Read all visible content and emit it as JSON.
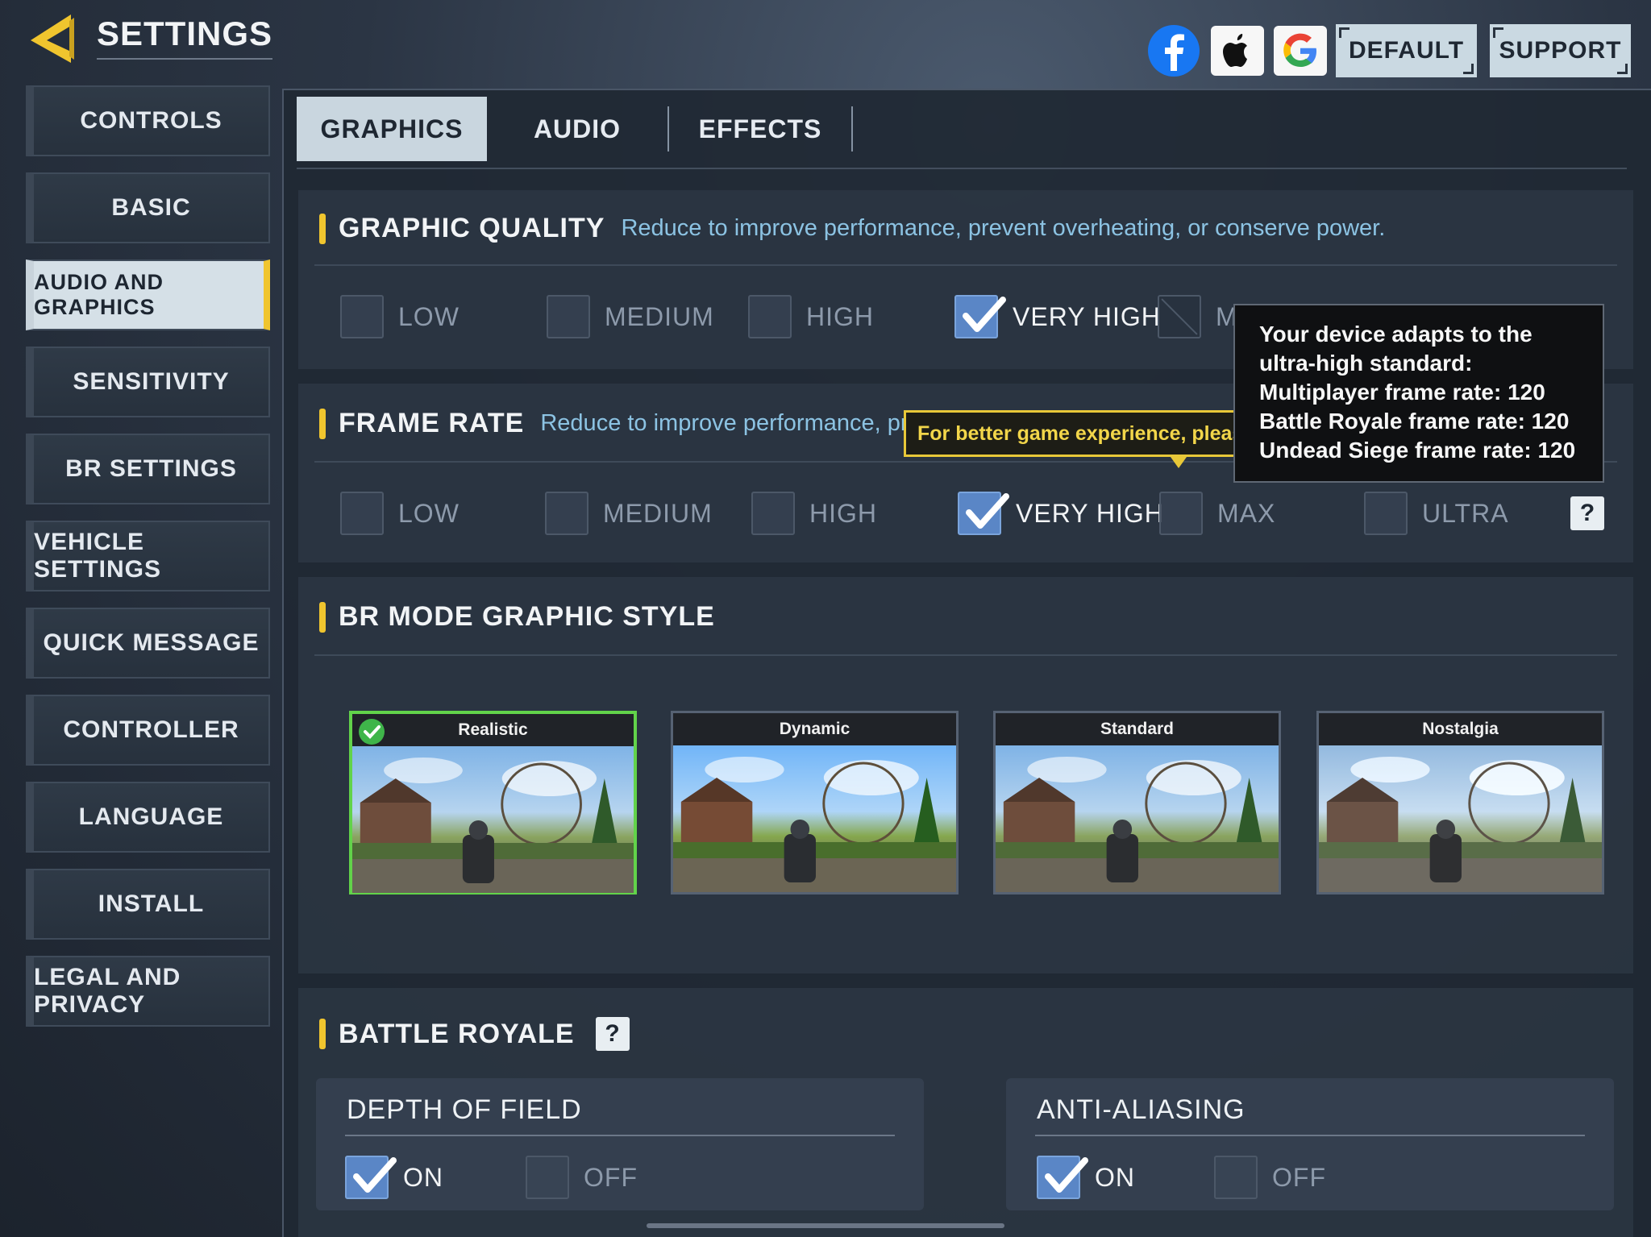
{
  "header": {
    "title": "SETTINGS",
    "default_label": "DEFAULT",
    "support_label": "SUPPORT",
    "colors": {
      "accent": "#f0c52e",
      "facebook": "#1877f2"
    }
  },
  "sidebar": {
    "items": [
      {
        "label": "CONTROLS"
      },
      {
        "label": "BASIC"
      },
      {
        "label": "AUDIO AND GRAPHICS"
      },
      {
        "label": "SENSITIVITY"
      },
      {
        "label": "BR SETTINGS"
      },
      {
        "label": "VEHICLE SETTINGS"
      },
      {
        "label": "QUICK MESSAGE"
      },
      {
        "label": "CONTROLLER"
      },
      {
        "label": "LANGUAGE"
      },
      {
        "label": "INSTALL"
      },
      {
        "label": "LEGAL AND PRIVACY"
      }
    ],
    "active_index": 2
  },
  "tabs": [
    {
      "label": "GRAPHICS"
    },
    {
      "label": "AUDIO"
    },
    {
      "label": "EFFECTS"
    }
  ],
  "graphic_quality": {
    "title": "GRAPHIC QUALITY",
    "desc": "Reduce to improve performance, prevent overheating, or conserve power.",
    "options": [
      "LOW",
      "MEDIUM",
      "HIGH",
      "VERY HIGH",
      "MAX"
    ],
    "selected": "VERY HIGH"
  },
  "frame_rate": {
    "title": "FRAME RATE",
    "desc": "Reduce to improve performance, prevent overheating, or conserve power.",
    "options": [
      "LOW",
      "MEDIUM",
      "HIGH",
      "VERY HIGH",
      "MAX",
      "ULTRA"
    ],
    "selected": "VERY HIGH"
  },
  "tooltip_yellow": "For better game experience, please maximize frame rate.",
  "tooltip_device": {
    "line1": "Your device adapts to the",
    "line2": "ultra-high standard:",
    "line3": "Multiplayer frame rate: 120",
    "line4": "Battle Royale frame rate: 120",
    "line5": "Undead Siege frame rate: 120"
  },
  "br_style": {
    "title": "BR MODE GRAPHIC STYLE",
    "cards": [
      {
        "label": "Realistic",
        "selected": true
      },
      {
        "label": "Dynamic",
        "selected": false
      },
      {
        "label": "Standard",
        "selected": false
      },
      {
        "label": "Nostalgia",
        "selected": false
      }
    ]
  },
  "battle_royale": {
    "title": "BATTLE ROYALE",
    "help": "?",
    "depth_of_field": {
      "title": "DEPTH OF FIELD",
      "on": "ON",
      "off": "OFF",
      "value": "ON"
    },
    "anti_aliasing": {
      "title": "ANTI-ALIASING",
      "on": "ON",
      "off": "OFF",
      "value": "ON"
    }
  },
  "help_glyph": "?"
}
